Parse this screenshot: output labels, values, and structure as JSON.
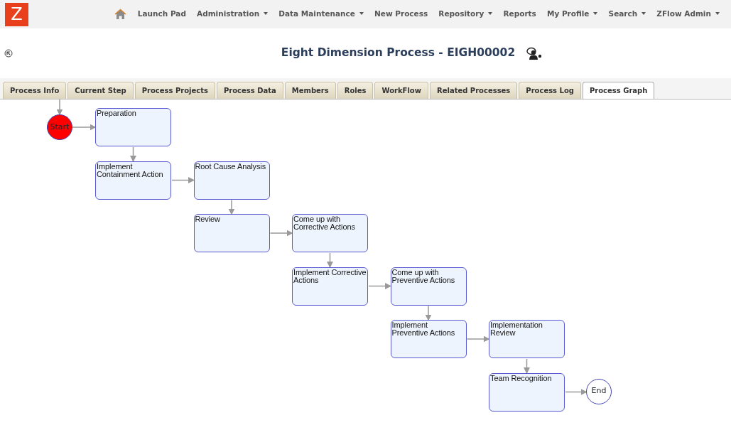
{
  "navbar": {
    "logo": "Z",
    "items": [
      {
        "label": "Launch Pad",
        "dropdown": false
      },
      {
        "label": "Administration",
        "dropdown": true
      },
      {
        "label": "Data Maintenance",
        "dropdown": true
      },
      {
        "label": "New Process",
        "dropdown": false
      },
      {
        "label": "Repository",
        "dropdown": true
      },
      {
        "label": "Reports",
        "dropdown": false
      },
      {
        "label": "My Profile",
        "dropdown": true
      },
      {
        "label": "Search",
        "dropdown": true
      },
      {
        "label": "ZFlow Admin",
        "dropdown": true
      }
    ]
  },
  "page": {
    "title": "Eight Dimension Process - EIGH00002"
  },
  "tabs": [
    {
      "label": "Process Info",
      "selected": false
    },
    {
      "label": "Current Step",
      "selected": false
    },
    {
      "label": "Process Projects",
      "selected": false
    },
    {
      "label": "Process Data",
      "selected": false
    },
    {
      "label": "Members",
      "selected": false
    },
    {
      "label": "Roles",
      "selected": false
    },
    {
      "label": "WorkFlow",
      "selected": false
    },
    {
      "label": "Related Processes",
      "selected": false
    },
    {
      "label": "Process Log",
      "selected": false
    },
    {
      "label": "Process Graph",
      "selected": true
    }
  ],
  "graph": {
    "start": "Start",
    "end": "End",
    "steps": [
      {
        "label": "Preparation"
      },
      {
        "label": "Implement Containment Action"
      },
      {
        "label": "Root Cause Analysis"
      },
      {
        "label": "Review"
      },
      {
        "label": "Come up with Corrective Actions"
      },
      {
        "label": "Implement Corrective Actions"
      },
      {
        "label": "Come up with Preventive Actions"
      },
      {
        "label": "Implement Preventive Actions"
      },
      {
        "label": "Implementation Review"
      },
      {
        "label": "Team Recognition"
      }
    ]
  }
}
